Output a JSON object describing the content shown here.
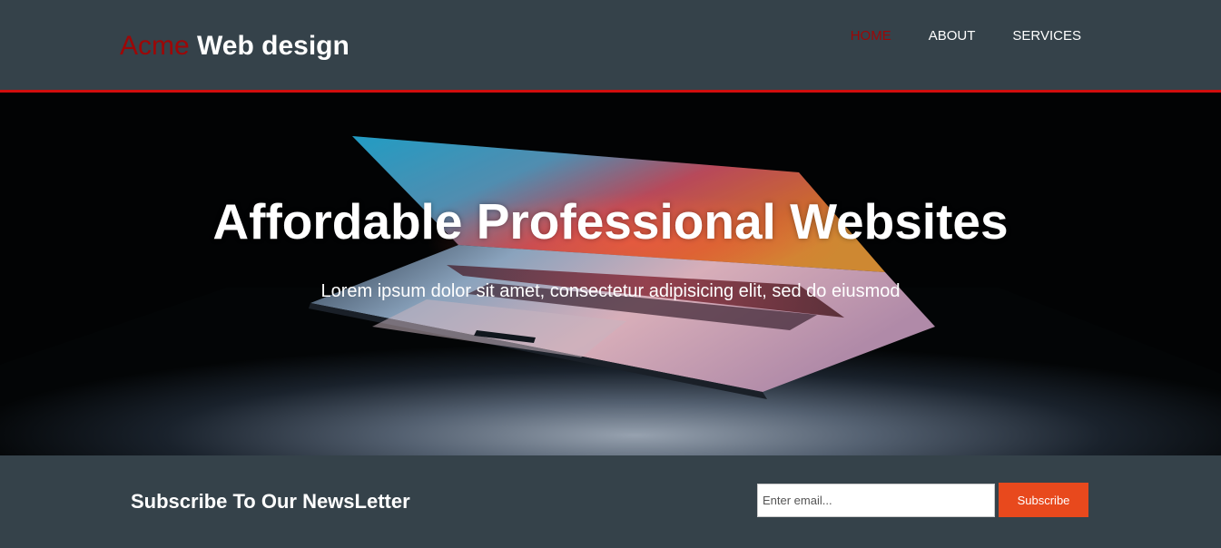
{
  "colors": {
    "header_bg": "#35424a",
    "accent_red": "#9d0707",
    "header_rule": "#d10d0d",
    "button_bg": "#e8491d",
    "hero_bg": "#020304"
  },
  "header": {
    "logo_highlight": "Acme",
    "logo_rest": " Web design",
    "nav": [
      {
        "label": "HOME",
        "current": true
      },
      {
        "label": "ABOUT",
        "current": false
      },
      {
        "label": "SERVICES",
        "current": false
      }
    ]
  },
  "showcase": {
    "title": "Affordable Professional Websites",
    "text": "Lorem ipsum dolor sit amet, consectetur adipisicing elit, sed do eiusmod",
    "background_image": "laptop-photo"
  },
  "newsletter": {
    "heading": "Subscribe To Our NewsLetter",
    "email_placeholder": "Enter email...",
    "email_value": "",
    "button_label": "Subscribe"
  }
}
